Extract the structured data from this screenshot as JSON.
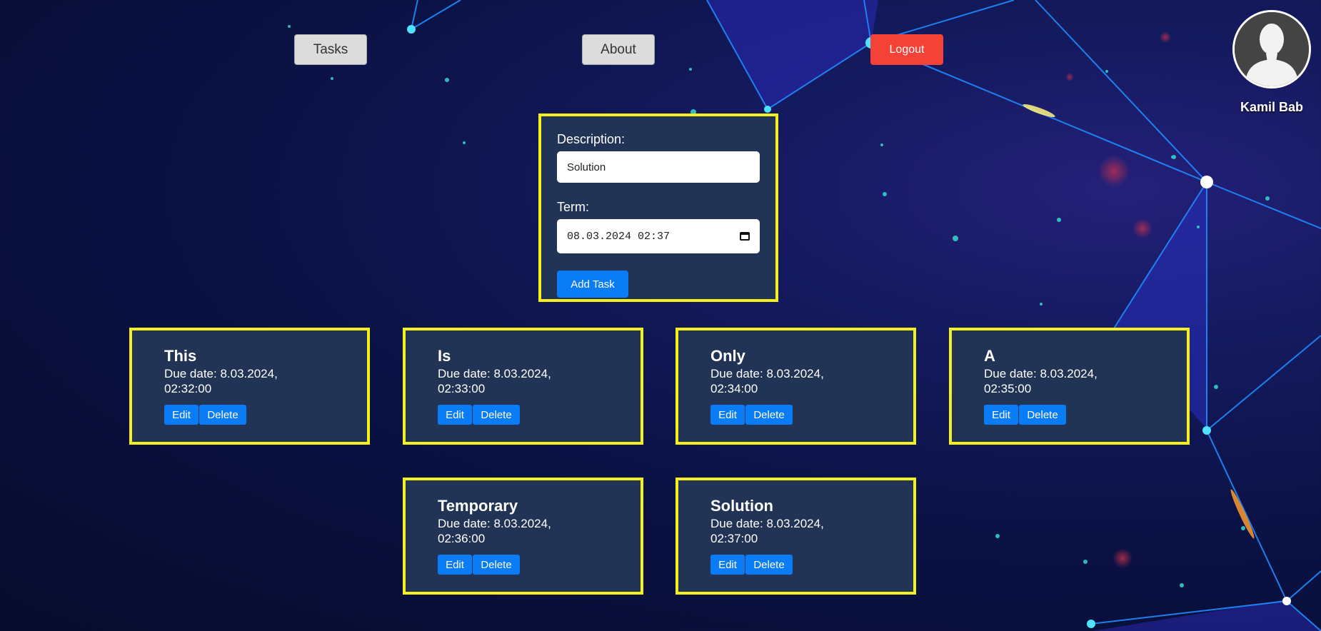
{
  "nav": {
    "tasks_label": "Tasks",
    "about_label": "About",
    "logout_label": "Logout"
  },
  "user": {
    "name": "Kamil Bab",
    "avatar_icon": "user-silhouette-icon"
  },
  "form": {
    "description_label": "Description:",
    "description_value": "Solution",
    "term_label": "Term:",
    "term_value": "08.03.2024 02:37",
    "term_icon": "calendar-icon",
    "submit_label": "Add Task"
  },
  "tasks": [
    {
      "title": "This",
      "due": "Due date: 8.03.2024, 02:32:00",
      "edit": "Edit",
      "delete": "Delete"
    },
    {
      "title": "Is",
      "due": "Due date: 8.03.2024, 02:33:00",
      "edit": "Edit",
      "delete": "Delete"
    },
    {
      "title": "Only",
      "due": "Due date: 8.03.2024, 02:34:00",
      "edit": "Edit",
      "delete": "Delete"
    },
    {
      "title": "A",
      "due": "Due date: 8.03.2024, 02:35:00",
      "edit": "Edit",
      "delete": "Delete"
    },
    {
      "title": "Temporary",
      "due": "Due date: 8.03.2024, 02:36:00",
      "edit": "Edit",
      "delete": "Delete"
    },
    {
      "title": "Solution",
      "due": "Due date: 8.03.2024, 02:37:00",
      "edit": "Edit",
      "delete": "Delete"
    }
  ],
  "colors": {
    "accent_blue": "#0a7cf5",
    "logout_red": "#f44336",
    "card_border_yellow": "#f4f01e",
    "card_bg": "#213456"
  }
}
